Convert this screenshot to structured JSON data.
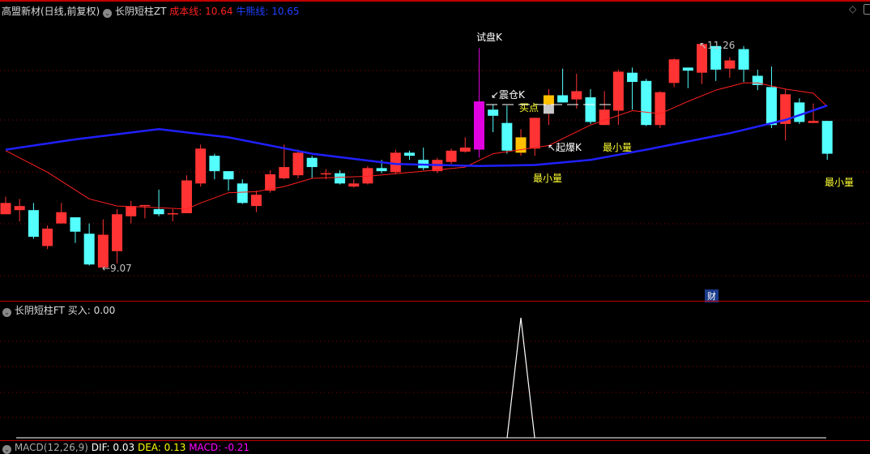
{
  "header": {
    "stock_title": "高盟新材(日线,前复权)",
    "indicator_name": "长阴短柱ZT",
    "cost_line_label": "成本线",
    "cost_line_value": "10.64",
    "bull_line_label": "牛熊线",
    "bull_line_value": "10.65",
    "colors": {
      "cost": "#ff2020",
      "bull": "#2040ff"
    }
  },
  "annotations": {
    "test_k": "试盘K",
    "shake_k": "↙震仓K",
    "buy_point": "买点",
    "launch_k": "↖起爆K",
    "min_vol_1": "最小量",
    "min_vol_2": "最小量",
    "min_vol_3": "最小量",
    "high_label": "↖11.26",
    "low_label": "←9.07",
    "finance_badge": "财"
  },
  "sub_panel": {
    "title": "长阴短柱FT",
    "buy_label": "买入",
    "buy_value": "0.00"
  },
  "macd_panel": {
    "title": "MACD(12,26,9)",
    "dif": "DIF: 0.03",
    "dea": "DEA: 0.13",
    "macd": "MACD: -0.21"
  },
  "chart_data": {
    "type": "candlestick",
    "price_range": [
      9.07,
      11.26
    ],
    "candles": [
      [
        9.59,
        9.76,
        9.59,
        9.7
      ],
      [
        9.63,
        9.74,
        9.52,
        9.67
      ],
      [
        9.63,
        9.7,
        9.35,
        9.37
      ],
      [
        9.28,
        9.48,
        9.25,
        9.45
      ],
      [
        9.5,
        9.7,
        9.5,
        9.61
      ],
      [
        9.56,
        9.56,
        9.31,
        9.42
      ],
      [
        9.4,
        9.5,
        9.09,
        9.1
      ],
      [
        9.07,
        9.54,
        9.07,
        9.39
      ],
      [
        9.23,
        9.64,
        9.11,
        9.59
      ],
      [
        9.57,
        9.72,
        9.5,
        9.67
      ],
      [
        9.67,
        9.68,
        9.55,
        9.68
      ],
      [
        9.64,
        9.83,
        9.57,
        9.59
      ],
      [
        9.59,
        9.64,
        9.52,
        9.6
      ],
      [
        9.6,
        9.97,
        9.6,
        9.92
      ],
      [
        9.89,
        10.27,
        9.86,
        10.23
      ],
      [
        10.16,
        10.18,
        9.93,
        10.01
      ],
      [
        10.01,
        10.01,
        9.82,
        9.93
      ],
      [
        9.89,
        9.93,
        9.69,
        9.7
      ],
      [
        9.67,
        9.82,
        9.61,
        9.78
      ],
      [
        9.82,
        10.02,
        9.8,
        9.98
      ],
      [
        9.94,
        10.27,
        9.93,
        10.05
      ],
      [
        9.97,
        10.22,
        9.94,
        10.19
      ],
      [
        10.14,
        10.16,
        9.94,
        10.05
      ],
      [
        9.98,
        10.03,
        9.93,
        9.99
      ],
      [
        9.99,
        10.02,
        9.88,
        9.89
      ],
      [
        9.86,
        9.93,
        9.85,
        9.89
      ],
      [
        9.89,
        10.06,
        9.88,
        10.04
      ],
      [
        10.04,
        10.12,
        9.99,
        10.01
      ],
      [
        10.0,
        10.22,
        9.98,
        10.19
      ],
      [
        10.19,
        10.21,
        10.12,
        10.16
      ],
      [
        10.12,
        10.24,
        10.02,
        10.04
      ],
      [
        10.01,
        10.14,
        9.99,
        10.12
      ],
      [
        10.1,
        10.23,
        10.08,
        10.21
      ],
      [
        10.2,
        10.34,
        10.19,
        10.24
      ],
      [
        10.22,
        11.21,
        10.14,
        10.69
      ],
      [
        10.61,
        10.66,
        10.39,
        10.55
      ],
      [
        10.48,
        10.65,
        10.18,
        10.21
      ],
      [
        10.19,
        10.42,
        10.16,
        10.34
      ],
      [
        10.23,
        10.53,
        10.16,
        10.53
      ],
      [
        10.57,
        10.81,
        10.46,
        10.75
      ],
      [
        10.75,
        11.01,
        10.68,
        10.68
      ],
      [
        10.71,
        10.96,
        10.62,
        10.79
      ],
      [
        10.73,
        10.81,
        10.47,
        10.49
      ],
      [
        10.46,
        10.79,
        10.46,
        10.61
      ],
      [
        10.6,
        11.0,
        10.46,
        10.98
      ],
      [
        10.97,
        11.02,
        10.61,
        10.88
      ],
      [
        10.89,
        10.91,
        10.45,
        10.46
      ],
      [
        10.46,
        10.79,
        10.43,
        10.78
      ],
      [
        10.87,
        11.11,
        10.83,
        11.1
      ],
      [
        11.02,
        11.02,
        10.82,
        10.99
      ],
      [
        10.97,
        11.26,
        10.86,
        11.25
      ],
      [
        11.23,
        11.23,
        10.89,
        11.0
      ],
      [
        11.01,
        11.12,
        10.92,
        11.09
      ],
      [
        11.2,
        11.23,
        10.88,
        11.0
      ],
      [
        10.94,
        11.0,
        10.8,
        10.85
      ],
      [
        10.83,
        11.03,
        10.43,
        10.46
      ],
      [
        10.47,
        10.81,
        10.31,
        10.76
      ],
      [
        10.68,
        10.72,
        10.47,
        10.49
      ],
      [
        10.48,
        10.67,
        10.48,
        10.5
      ],
      [
        10.5,
        10.5,
        10.12,
        10.18
      ]
    ],
    "special_candles": {
      "test_k": 34,
      "gold": [
        37,
        39
      ]
    },
    "cost_line": [
      [
        0,
        10.21
      ],
      [
        3,
        10.0
      ],
      [
        6,
        9.74
      ],
      [
        8,
        9.67
      ],
      [
        10,
        9.66
      ],
      [
        13,
        9.64
      ],
      [
        14,
        9.7
      ],
      [
        16,
        9.8
      ],
      [
        18,
        9.81
      ],
      [
        20,
        9.86
      ],
      [
        22,
        9.94
      ],
      [
        26,
        9.96
      ],
      [
        30,
        10.01
      ],
      [
        33,
        10.05
      ],
      [
        35,
        10.18
      ],
      [
        37,
        10.22
      ],
      [
        39,
        10.26
      ],
      [
        42,
        10.46
      ],
      [
        45,
        10.6
      ],
      [
        47,
        10.57
      ],
      [
        49,
        10.69
      ],
      [
        51,
        10.8
      ],
      [
        53,
        10.87
      ],
      [
        54,
        10.87
      ],
      [
        56,
        10.81
      ],
      [
        58,
        10.77
      ],
      [
        59,
        10.64
      ]
    ],
    "bull_line": [
      [
        0,
        10.22
      ],
      [
        5,
        10.32
      ],
      [
        11,
        10.42
      ],
      [
        16,
        10.34
      ],
      [
        22,
        10.18
      ],
      [
        28,
        10.08
      ],
      [
        34,
        10.06
      ],
      [
        38,
        10.07
      ],
      [
        42,
        10.12
      ],
      [
        46,
        10.22
      ],
      [
        52,
        10.38
      ],
      [
        56,
        10.51
      ],
      [
        59,
        10.65
      ]
    ],
    "buy_signal": {
      "index": 37,
      "value": 1,
      "others": 0
    },
    "colors": {
      "up": "#ff3333",
      "down": "#54ffff",
      "test_k": "#e000e0",
      "gold": "#ffc000",
      "cost": "#ff2020",
      "bull": "#2020ff"
    }
  }
}
